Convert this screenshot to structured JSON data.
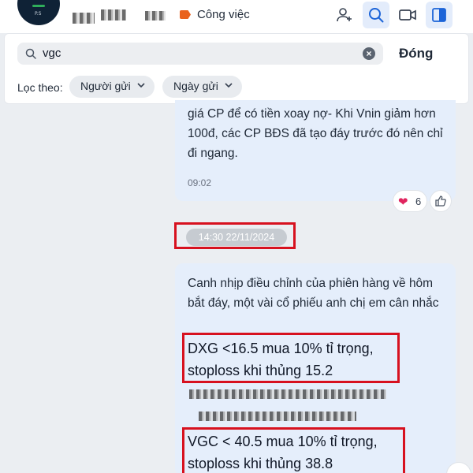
{
  "header": {
    "category_label": "Công việc",
    "colors": {
      "category_tag": "#e9621d",
      "active_button": "#e3ecfb"
    },
    "icons": [
      "add-member-icon",
      "search-icon",
      "video-call-icon",
      "panel-toggle-icon"
    ]
  },
  "search": {
    "value": "vgc",
    "close_label": "Đóng",
    "filter_label": "Lọc theo:",
    "chips": [
      "Người gửi",
      "Ngày gửi"
    ]
  },
  "messages": {
    "first": {
      "text": "giá CP để có tiền xoay nợ- Khi Vnin giảm hơn 100đ, các CP BĐS đã tạo đáy trước đó nên chỉ đi ngang.",
      "time": "09:02",
      "reaction_count": "6"
    },
    "date_separator": "14:30 22/11/2024",
    "second": {
      "intro": "Canh nhịp điều chỉnh của phiên hàng về hôm bắt đáy, một vài cổ phiếu anh chị em cân nhắc",
      "dxg_line1": "DXG <16.5 mua 10% tỉ trọng,",
      "dxg_line2": "stoploss khi thủng 15.2",
      "vgc_line1": "VGC < 40.5 mua 10% tỉ trọng,",
      "vgc_line2": "stoploss khi thủng 38.8"
    }
  },
  "colors": {
    "highlight_box": "#d7111f",
    "bubble": "#e5eefb",
    "background": "#ebeef2"
  }
}
